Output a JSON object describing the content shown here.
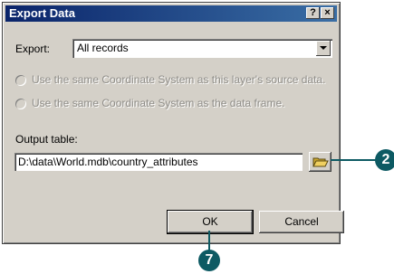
{
  "dialog": {
    "title": "Export Data",
    "help_btn": "?",
    "close_btn": "×",
    "export_label": "Export:",
    "export_value": "All records",
    "radio1": "Use the same Coordinate System as this layer's source data.",
    "radio2": "Use the same Coordinate System as the data frame.",
    "output_label": "Output table:",
    "output_value": "D:\\data\\World.mdb\\country_attributes",
    "ok_label": "OK",
    "cancel_label": "Cancel"
  },
  "callouts": {
    "browse_step": "2",
    "ok_step": "7"
  },
  "colors": {
    "callout": "#0d5a63",
    "title_start": "#0a246a",
    "title_end": "#3a6ea5"
  }
}
